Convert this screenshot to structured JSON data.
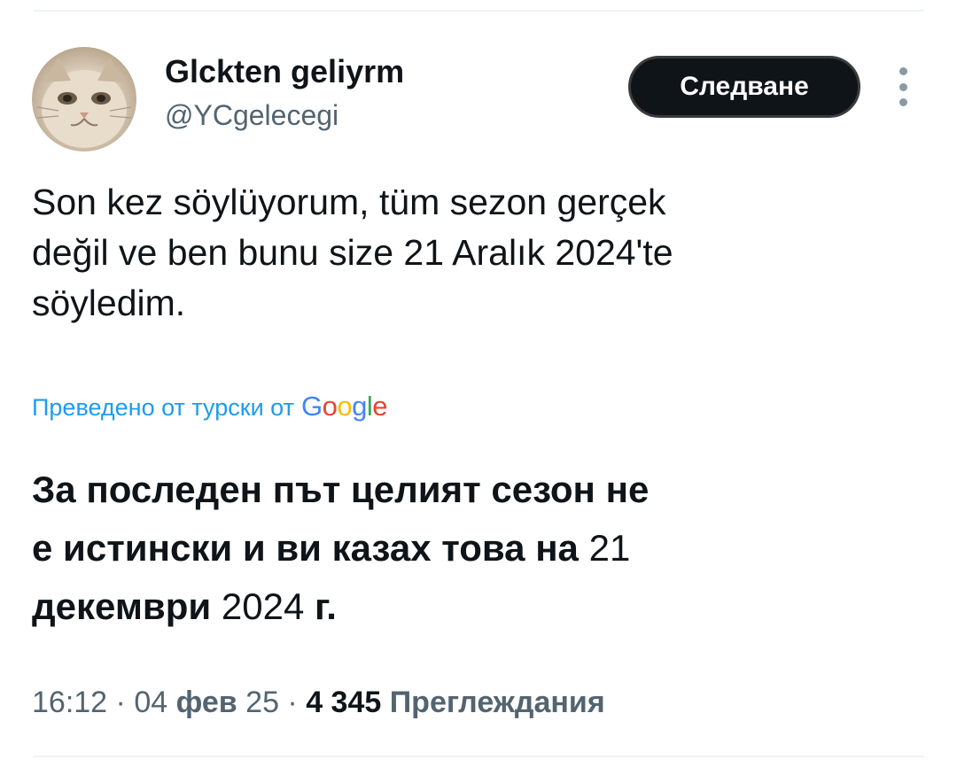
{
  "tweet": {
    "author": {
      "display_name": "Glckten geliyrm",
      "handle": "@YCgelecegi"
    },
    "follow_label": "Следване",
    "more_icon": "more-vertical-icon",
    "text_lines": [
      "Son kez söylüyorum, tüm sezon gerçek",
      "değil ve ben bunu size 21 Aralık 2024'te",
      "söyledim."
    ],
    "translated_by": {
      "label": "Преведено от турски от",
      "logo_letters": [
        "G",
        "o",
        "o",
        "g",
        "l",
        "e"
      ]
    },
    "translation": {
      "line1": "За последен път целият сезон не",
      "line2_text": "е истински и ви казах това на ",
      "line2_num": "21",
      "line3_text": "декември ",
      "line3_num": "2024",
      "line3_suffix": " г."
    },
    "meta": {
      "time": "16:12",
      "sep1": " · ",
      "date_day": "04",
      "date_month": " фев ",
      "date_year": "25",
      "sep2": " · ",
      "views_count": "4 345",
      "views_label": " Преглеждания"
    }
  },
  "colors": {
    "text": "#0f1419",
    "secondary": "#536471",
    "link": "#1d9bf0",
    "button_bg": "#0f1419",
    "divider": "#eff3f4"
  }
}
